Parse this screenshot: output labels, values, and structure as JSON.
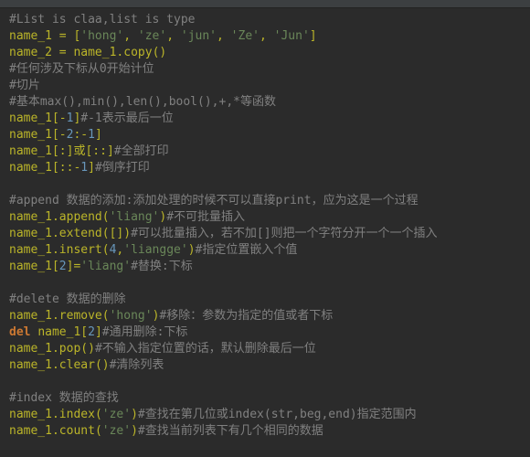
{
  "lines": [
    [
      [
        "c",
        "#List is claa,list is type"
      ]
    ],
    [
      [
        "id",
        "name_1"
      ],
      [
        "op",
        " = "
      ],
      [
        "br",
        "["
      ],
      [
        "str",
        "'hong'"
      ],
      [
        "op",
        ", "
      ],
      [
        "str",
        "'ze'"
      ],
      [
        "op",
        ", "
      ],
      [
        "str",
        "'jun'"
      ],
      [
        "op",
        ", "
      ],
      [
        "str",
        "'Ze'"
      ],
      [
        "op",
        ", "
      ],
      [
        "str",
        "'Jun'"
      ],
      [
        "br",
        "]"
      ]
    ],
    [
      [
        "id",
        "name_2"
      ],
      [
        "op",
        " = "
      ],
      [
        "id",
        "name_1"
      ],
      [
        "op",
        "."
      ],
      [
        "id",
        "copy"
      ],
      [
        "br",
        "()"
      ]
    ],
    [
      [
        "c",
        "#任何涉及下标从0开始计位"
      ]
    ],
    [
      [
        "c",
        "#切片"
      ]
    ],
    [
      [
        "c",
        "#基本max(),min(),len(),bool(),+,*等函数"
      ]
    ],
    [
      [
        "id",
        "name_1"
      ],
      [
        "br",
        "["
      ],
      [
        "op",
        "-"
      ],
      [
        "num",
        "1"
      ],
      [
        "br",
        "]"
      ],
      [
        "c",
        "#-1表示最后一位"
      ]
    ],
    [
      [
        "id",
        "name_1"
      ],
      [
        "br",
        "["
      ],
      [
        "op",
        "-"
      ],
      [
        "num",
        "2"
      ],
      [
        "op",
        ":"
      ],
      [
        "op",
        "-"
      ],
      [
        "num",
        "1"
      ],
      [
        "br",
        "]"
      ]
    ],
    [
      [
        "id",
        "name_1"
      ],
      [
        "br",
        "["
      ],
      [
        "op",
        ":"
      ],
      [
        "br",
        "]"
      ],
      [
        "id",
        "或"
      ],
      [
        "br",
        "["
      ],
      [
        "op",
        ":"
      ],
      [
        "op",
        ":"
      ],
      [
        "br",
        "]"
      ],
      [
        "c",
        "#全部打印"
      ]
    ],
    [
      [
        "id",
        "name_1"
      ],
      [
        "br",
        "["
      ],
      [
        "op",
        ":"
      ],
      [
        "op",
        ":"
      ],
      [
        "op",
        "-"
      ],
      [
        "num",
        "1"
      ],
      [
        "br",
        "]"
      ],
      [
        "c",
        "#倒序打印"
      ]
    ],
    [],
    [
      [
        "c",
        "#append 数据的添加:添加处理的时候不可以直接print，应为这是一个过程"
      ]
    ],
    [
      [
        "id",
        "name_1"
      ],
      [
        "op",
        "."
      ],
      [
        "id",
        "append"
      ],
      [
        "br",
        "("
      ],
      [
        "str",
        "'liang'"
      ],
      [
        "br",
        ")"
      ],
      [
        "c",
        "#不可批量插入"
      ]
    ],
    [
      [
        "id",
        "name_1"
      ],
      [
        "op",
        "."
      ],
      [
        "id",
        "extend"
      ],
      [
        "br",
        "("
      ],
      [
        "br",
        "["
      ],
      [
        "br",
        "]"
      ],
      [
        "br",
        ")"
      ],
      [
        "c",
        "#可以批量插入，若不加[]则把一个字符分开一个一个插入"
      ]
    ],
    [
      [
        "id",
        "name_1"
      ],
      [
        "op",
        "."
      ],
      [
        "id",
        "insert"
      ],
      [
        "br",
        "("
      ],
      [
        "num",
        "4"
      ],
      [
        "op",
        ","
      ],
      [
        "str",
        "'liangge'"
      ],
      [
        "br",
        ")"
      ],
      [
        "c",
        "#指定位置嵌入个值"
      ]
    ],
    [
      [
        "id",
        "name_1"
      ],
      [
        "br",
        "["
      ],
      [
        "num",
        "2"
      ],
      [
        "br",
        "]"
      ],
      [
        "op",
        "="
      ],
      [
        "str",
        "'liang'"
      ],
      [
        "c",
        "#替换:下标"
      ]
    ],
    [],
    [
      [
        "c",
        "#delete 数据的删除"
      ]
    ],
    [
      [
        "id",
        "name_1"
      ],
      [
        "op",
        "."
      ],
      [
        "id",
        "remove"
      ],
      [
        "br",
        "("
      ],
      [
        "str",
        "'hong'"
      ],
      [
        "br",
        ")"
      ],
      [
        "c",
        "#移除：参数为指定的值或者下标"
      ]
    ],
    [
      [
        "kw",
        "del"
      ],
      [
        "op",
        " "
      ],
      [
        "id",
        "name_1"
      ],
      [
        "br",
        "["
      ],
      [
        "num",
        "2"
      ],
      [
        "br",
        "]"
      ],
      [
        "c",
        "#通用删除:下标"
      ]
    ],
    [
      [
        "id",
        "name_1"
      ],
      [
        "op",
        "."
      ],
      [
        "id",
        "pop"
      ],
      [
        "br",
        "()"
      ],
      [
        "c",
        "#不输入指定位置的话，默认删除最后一位"
      ]
    ],
    [
      [
        "id",
        "name_1"
      ],
      [
        "op",
        "."
      ],
      [
        "id",
        "clear"
      ],
      [
        "br",
        "()"
      ],
      [
        "c",
        "#清除列表"
      ]
    ],
    [],
    [
      [
        "c",
        "#index 数据的查找"
      ]
    ],
    [
      [
        "id",
        "name_1"
      ],
      [
        "op",
        "."
      ],
      [
        "id",
        "index"
      ],
      [
        "br",
        "("
      ],
      [
        "str",
        "'ze'"
      ],
      [
        "br",
        ")"
      ],
      [
        "c",
        "#查找在第几位或index(str,beg,end)指定范围内"
      ]
    ],
    [
      [
        "id",
        "name_1"
      ],
      [
        "op",
        "."
      ],
      [
        "id",
        "count"
      ],
      [
        "br",
        "("
      ],
      [
        "str",
        "'ze'"
      ],
      [
        "br",
        ")"
      ],
      [
        "c",
        "#查找当前列表下有几个相同的数据"
      ]
    ]
  ],
  "highlighted_lines": [],
  "colors": {
    "bg": "#2b2b2b",
    "comment": "#808080",
    "keyword": "#cc7832",
    "string": "#6a8759",
    "number": "#6897bb",
    "identifier": "#a9b7c6"
  }
}
